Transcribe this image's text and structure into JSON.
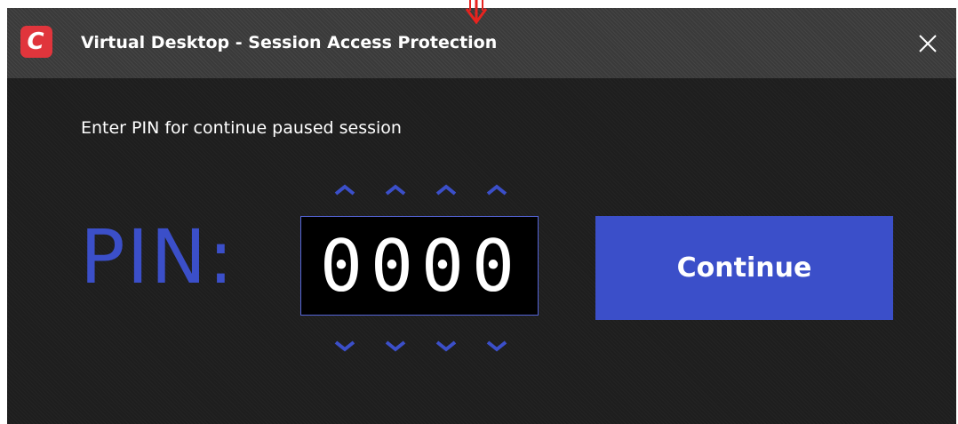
{
  "window": {
    "title": "Virtual Desktop - Session Access Protection",
    "logo_letter": "C",
    "close_icon": "close-icon",
    "accent_color": "#3b4fc9",
    "logo_color": "#e0353c"
  },
  "main": {
    "prompt": "Enter PIN for continue paused session",
    "pin_label": "PIN:",
    "pin_digits": [
      "0",
      "0",
      "0",
      "0"
    ],
    "increment_icon": "chevron-up-icon",
    "decrement_icon": "chevron-down-icon",
    "continue_label": "Continue"
  },
  "annotation": {
    "pointer_icon": "arrow-down-icon",
    "color": "#e8231f"
  }
}
